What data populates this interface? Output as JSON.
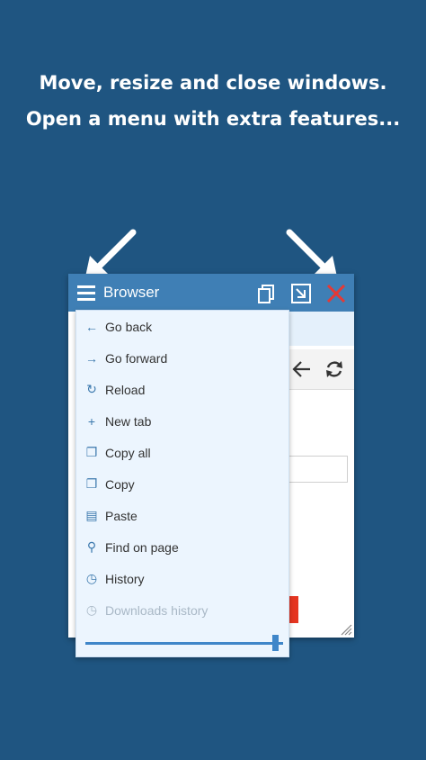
{
  "headline": {
    "line1": "Move, resize and close windows.",
    "line2": "Open a menu with extra features..."
  },
  "window": {
    "title": "Browser",
    "icons": {
      "menu": "hamburger-icon",
      "copy": "copy-window-icon",
      "minimize": "minimize-window-icon",
      "close": "close-icon",
      "back": "arrow-left-icon",
      "reload": "reload-icon",
      "resize": "resize-grip-icon"
    },
    "colors": {
      "titlebar": "#3f7fb5",
      "close": "#e53935"
    }
  },
  "menu": {
    "items": [
      {
        "label": "Go back",
        "icon": "arrow-left-icon",
        "glyph": "←",
        "enabled": true
      },
      {
        "label": "Go forward",
        "icon": "arrow-right-icon",
        "glyph": "→",
        "enabled": true
      },
      {
        "label": "Reload",
        "icon": "reload-icon",
        "glyph": "↻",
        "enabled": true
      },
      {
        "label": "New tab",
        "icon": "plus-icon",
        "glyph": "+",
        "enabled": true
      },
      {
        "label": "Copy all",
        "icon": "copy-icon",
        "glyph": "❐",
        "enabled": true
      },
      {
        "label": "Copy",
        "icon": "copy-icon",
        "glyph": "❐",
        "enabled": true
      },
      {
        "label": "Paste",
        "icon": "clipboard-icon",
        "glyph": "▤",
        "enabled": true
      },
      {
        "label": "Find on page",
        "icon": "search-icon",
        "glyph": "⚲",
        "enabled": true
      },
      {
        "label": "History",
        "icon": "history-icon",
        "glyph": "◷",
        "enabled": true
      },
      {
        "label": "Downloads history",
        "icon": "downloads-history-icon",
        "glyph": "◷",
        "enabled": false
      }
    ],
    "opacity_slider": 0.96
  }
}
